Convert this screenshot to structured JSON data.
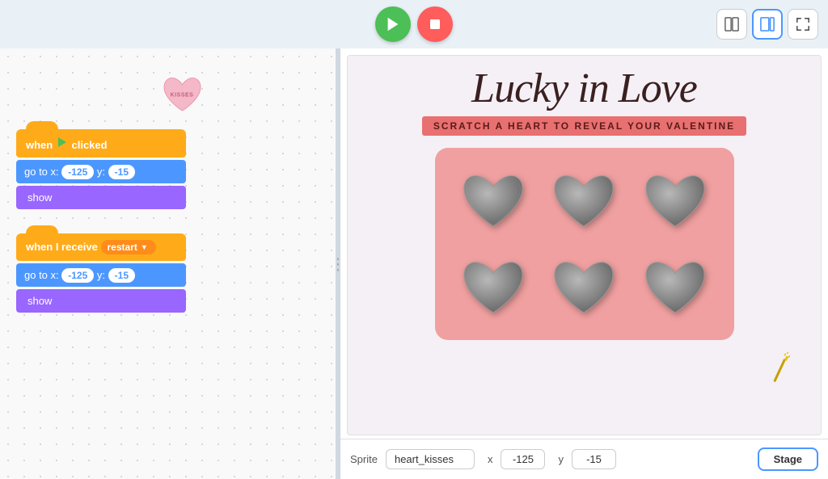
{
  "toolbar": {
    "green_flag_label": "Green Flag",
    "stop_label": "Stop",
    "layout_btn1": "⊞",
    "layout_btn2": "⊡",
    "fullscreen_btn": "⤢"
  },
  "code_panel": {
    "kisses_label": "KISSES",
    "block_group_1": {
      "hat": "when",
      "flag": "🏳",
      "hat_suffix": "clicked",
      "motion_label": "go to x:",
      "x_value": "-125",
      "y_label": "y:",
      "y_value": "-15",
      "show_label": "show"
    },
    "block_group_2": {
      "when_label": "when I receive",
      "dropdown_value": "restart",
      "motion_label": "go to x:",
      "x_value": "-125",
      "y_label": "y:",
      "y_value": "-15",
      "show_label": "show"
    }
  },
  "stage": {
    "title": "Lucky in Love",
    "subtitle": "SCRATCH A HEART TO REVEAL YOUR VALENTINE",
    "hearts_count": 6,
    "wand_icon": "✦"
  },
  "bottom_bar": {
    "sprite_label": "Sprite",
    "sprite_name": "heart_kisses",
    "x_label": "x",
    "x_value": "-125",
    "y_label": "y",
    "y_value": "-15",
    "stage_label": "Stage"
  }
}
